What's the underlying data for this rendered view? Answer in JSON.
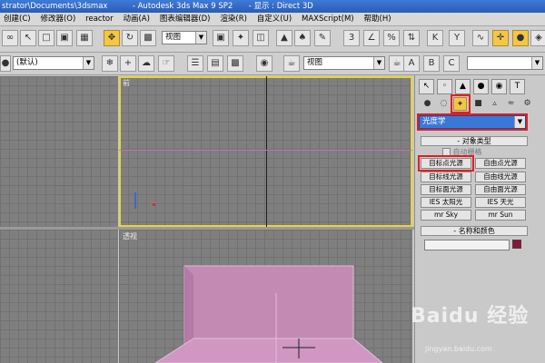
{
  "titlebar": {
    "path": "strator\\Documents\\3dsmax",
    "app": "- Autodesk 3ds Max 9 SP2",
    "display": "- 显示 : Direct 3D"
  },
  "menu": [
    "创建(C)",
    "修改器(O)",
    "reactor",
    "动画(A)",
    "图表编辑器(D)",
    "渲染(R)",
    "自定义(U)",
    "MAXScript(M)",
    "帮助(H)"
  ],
  "toolbar": {
    "view_dropdown": "视图",
    "selection_filter": "(默认)",
    "viewport_dropdown": "视图"
  },
  "viewports": {
    "front_label": "前",
    "perspective_label": "透视"
  },
  "panel": {
    "category_dropdown": "光度学",
    "object_type_header": "对象类型",
    "autogrid": "自动栅格",
    "buttons": [
      [
        "目标点光源",
        "自由点光源"
      ],
      [
        "目标线光源",
        "自由线光源"
      ],
      [
        "目标面光源",
        "自由面光源"
      ],
      [
        "IES 太阳光",
        "IES 天光"
      ],
      [
        "mr Sky",
        "mr Sun"
      ]
    ],
    "name_color_header": "名称和颜色",
    "name_value": "",
    "color_swatch": "#8b1538"
  },
  "watermark": {
    "logo": "Baidu 经验",
    "url": "jingyan.baidu.com"
  }
}
